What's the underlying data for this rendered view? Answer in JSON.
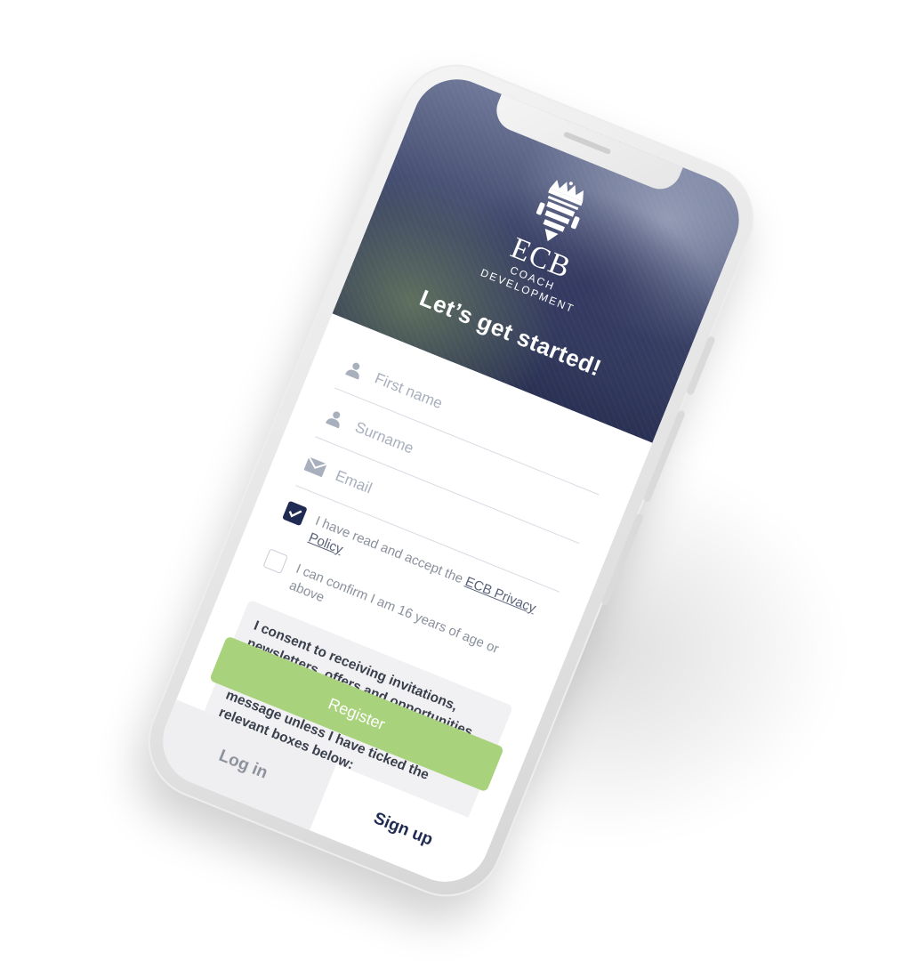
{
  "header": {
    "logo_title": "ECB",
    "logo_line1": "COACH",
    "logo_line2": "DEVELOPMENT",
    "headline": "Let’s get started!"
  },
  "form": {
    "first_name": {
      "placeholder": "First name",
      "value": "",
      "icon": "person-icon"
    },
    "surname": {
      "placeholder": "Surname",
      "value": "",
      "icon": "person-icon"
    },
    "email": {
      "placeholder": "Email",
      "value": "",
      "icon": "envelope-icon"
    },
    "privacy": {
      "checked": true,
      "text": "I have read and accept the ",
      "link_text": "ECB Privacy Policy"
    },
    "age": {
      "checked": false,
      "text": "I can confirm I am 16 years of age or above"
    },
    "consent_text": "I consent to receiving invitations, newsletters, offers and opportunities and other initiatives by email, phone, post or as an on-screen personalised message unless I have ticked the relevant boxes below:",
    "register_label": "Register"
  },
  "tabs": {
    "login_label": "Log in",
    "signup_label": "Sign up",
    "active": "signup"
  },
  "colors": {
    "navy": "#1f2b52",
    "register_green": "#a9d27c",
    "placeholder_grey": "#a8afbd"
  }
}
